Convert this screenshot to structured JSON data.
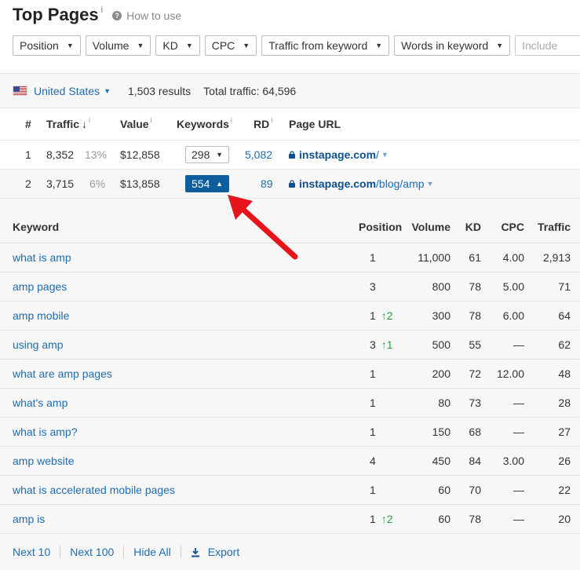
{
  "header": {
    "title": "Top Pages",
    "title_info": "i",
    "howto_icon": "question-icon",
    "howto_label": "How to use"
  },
  "filters": [
    {
      "label": "Position"
    },
    {
      "label": "Volume"
    },
    {
      "label": "KD"
    },
    {
      "label": "CPC"
    },
    {
      "label": "Traffic from keyword"
    },
    {
      "label": "Words in keyword"
    }
  ],
  "include_placeholder": "Include",
  "country_bar": {
    "country": "United States",
    "flag_icon": "us-flag-icon",
    "results": "1,503 results",
    "total_traffic": "Total traffic: 64,596"
  },
  "pages_table": {
    "columns": {
      "num": "#",
      "traffic": "Traffic",
      "value": "Value",
      "keywords": "Keywords",
      "rd": "RD",
      "url": "Page URL"
    },
    "sort_indicator": "↓",
    "info": "i",
    "rows": [
      {
        "num": "1",
        "traffic": "8,352",
        "pct": "13%",
        "value": "$12,858",
        "keywords": "298",
        "rd": "5,082",
        "domain": "instapage.com",
        "path": "/"
      },
      {
        "num": "2",
        "traffic": "3,715",
        "pct": "6%",
        "value": "$13,858",
        "keywords": "554",
        "rd": "89",
        "domain": "instapage.com",
        "path": "/blog/amp"
      }
    ]
  },
  "keywords_table": {
    "columns": {
      "keyword": "Keyword",
      "position": "Position",
      "volume": "Volume",
      "kd": "KD",
      "cpc": "CPC",
      "traffic": "Traffic"
    },
    "rows": [
      {
        "keyword": "what is amp",
        "position": "1",
        "change": "",
        "volume": "11,000",
        "kd": "61",
        "cpc": "4.00",
        "traffic": "2,913"
      },
      {
        "keyword": "amp pages",
        "position": "3",
        "change": "",
        "volume": "800",
        "kd": "78",
        "cpc": "5.00",
        "traffic": "71"
      },
      {
        "keyword": "amp mobile",
        "position": "1",
        "change": "↑2",
        "volume": "300",
        "kd": "78",
        "cpc": "6.00",
        "traffic": "64"
      },
      {
        "keyword": "using amp",
        "position": "3",
        "change": "↑1",
        "volume": "500",
        "kd": "55",
        "cpc": "—",
        "traffic": "62"
      },
      {
        "keyword": "what are amp pages",
        "position": "1",
        "change": "",
        "volume": "200",
        "kd": "72",
        "cpc": "12.00",
        "traffic": "48"
      },
      {
        "keyword": "what's amp",
        "position": "1",
        "change": "",
        "volume": "80",
        "kd": "73",
        "cpc": "—",
        "traffic": "28"
      },
      {
        "keyword": "what is amp?",
        "position": "1",
        "change": "",
        "volume": "150",
        "kd": "68",
        "cpc": "—",
        "traffic": "27"
      },
      {
        "keyword": "amp website",
        "position": "4",
        "change": "",
        "volume": "450",
        "kd": "84",
        "cpc": "3.00",
        "traffic": "26"
      },
      {
        "keyword": "what is accelerated mobile pages",
        "position": "1",
        "change": "",
        "volume": "60",
        "kd": "70",
        "cpc": "—",
        "traffic": "22"
      },
      {
        "keyword": "amp is",
        "position": "1",
        "change": "↑2",
        "volume": "60",
        "kd": "78",
        "cpc": "—",
        "traffic": "20"
      }
    ]
  },
  "footer": {
    "next10": "Next 10",
    "next100": "Next 100",
    "hide_all": "Hide All",
    "export": "Export"
  },
  "colors": {
    "link": "#1f6cb0",
    "active_button": "#0d5e9e",
    "position_up": "#2e9b3f",
    "annotation_arrow": "#e8141b"
  }
}
